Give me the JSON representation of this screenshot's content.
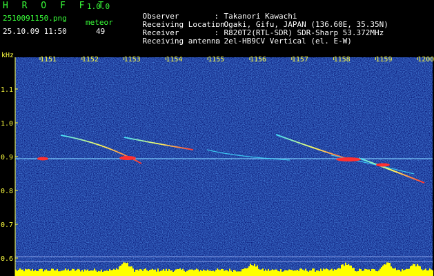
{
  "app": {
    "logo": "H R O F F T",
    "version": "1.0.0"
  },
  "file": {
    "name": "2510091150.png",
    "datetime": "25.10.09 11:50",
    "mode_label": "meteor",
    "count": "49"
  },
  "info": [
    {
      "label": "Observer",
      "value": "Takanori Kawachi"
    },
    {
      "label": "Receiving Location",
      "value": "Ogaki, Gifu, JAPAN (136.60E, 35.35N)"
    },
    {
      "label": "Receiver",
      "value": "R820T2(RTL-SDR) SDR-Sharp 53.372MHz"
    },
    {
      "label": "Receiving antenna",
      "value": "2el-HB9CV Vertical (el. E-W)"
    }
  ],
  "axis": {
    "y_unit": "kHz",
    "y_ticks": [
      "1.1",
      "1.0",
      "0.9",
      "0.8",
      "0.7",
      "0.6"
    ],
    "x_ticks": [
      "1151",
      "1152",
      "1153",
      "1154",
      "1155",
      "1156",
      "1157",
      "1158",
      "1159",
      "1200"
    ]
  },
  "colors": {
    "background": "#0a1a7a",
    "header_text": "#39ff39",
    "axis_text": "#ffff40",
    "carrier": "#7fd0ff",
    "meteor_hot": "#ff3030",
    "bars": "#ffff00"
  }
}
